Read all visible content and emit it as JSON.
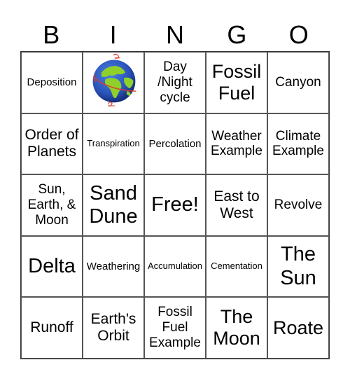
{
  "header": {
    "letters": [
      "B",
      "I",
      "N",
      "G",
      "O"
    ]
  },
  "card": {
    "rows": [
      [
        "Deposition",
        "[globe-image]",
        "Day /Night cycle",
        "Fossil Fuel",
        "Canyon"
      ],
      [
        "Order of Planets",
        "Transpiration",
        "Percolation",
        "Weather Example",
        "Climate Example"
      ],
      [
        "Sun, Earth, & Moon",
        "Sand Dune",
        "Free!",
        "East to West",
        "Revolve"
      ],
      [
        "Delta",
        "Weathering",
        "Accumulation",
        "Cementation",
        "The Sun"
      ],
      [
        "Runoff",
        "Earth's Orbit",
        "Fossil Fuel Example",
        "The Moon",
        "Roate"
      ]
    ]
  },
  "cells": {
    "r0c0": "Deposition",
    "r0c1_icon": "rotating-earth-globe-icon",
    "r0c2": "Day /Night cycle",
    "r0c3": "Fossil Fuel",
    "r0c4": "Canyon",
    "r1c0": "Order of Planets",
    "r1c1": "Transpiration",
    "r1c2": "Percolation",
    "r1c3": "Weather Example",
    "r1c4": "Climate Example",
    "r2c0": "Sun, Earth, & Moon",
    "r2c1": "Sand Dune",
    "r2c2": "Free!",
    "r2c3": "East to West",
    "r2c4": "Revolve",
    "r3c0": "Delta",
    "r3c1": "Weathering",
    "r3c2": "Accumulation",
    "r3c3": "Cementation",
    "r3c4": "The Sun",
    "r4c0": "Runoff",
    "r4c1": "Earth's Orbit",
    "r4c2": "Fossil Fuel Example",
    "r4c3": "The Moon",
    "r4c4": "Roate"
  },
  "colors": {
    "ocean": "#2a52b8",
    "land": "#8fd12a",
    "orbit": "#e03a2e",
    "grid": "#555555"
  }
}
